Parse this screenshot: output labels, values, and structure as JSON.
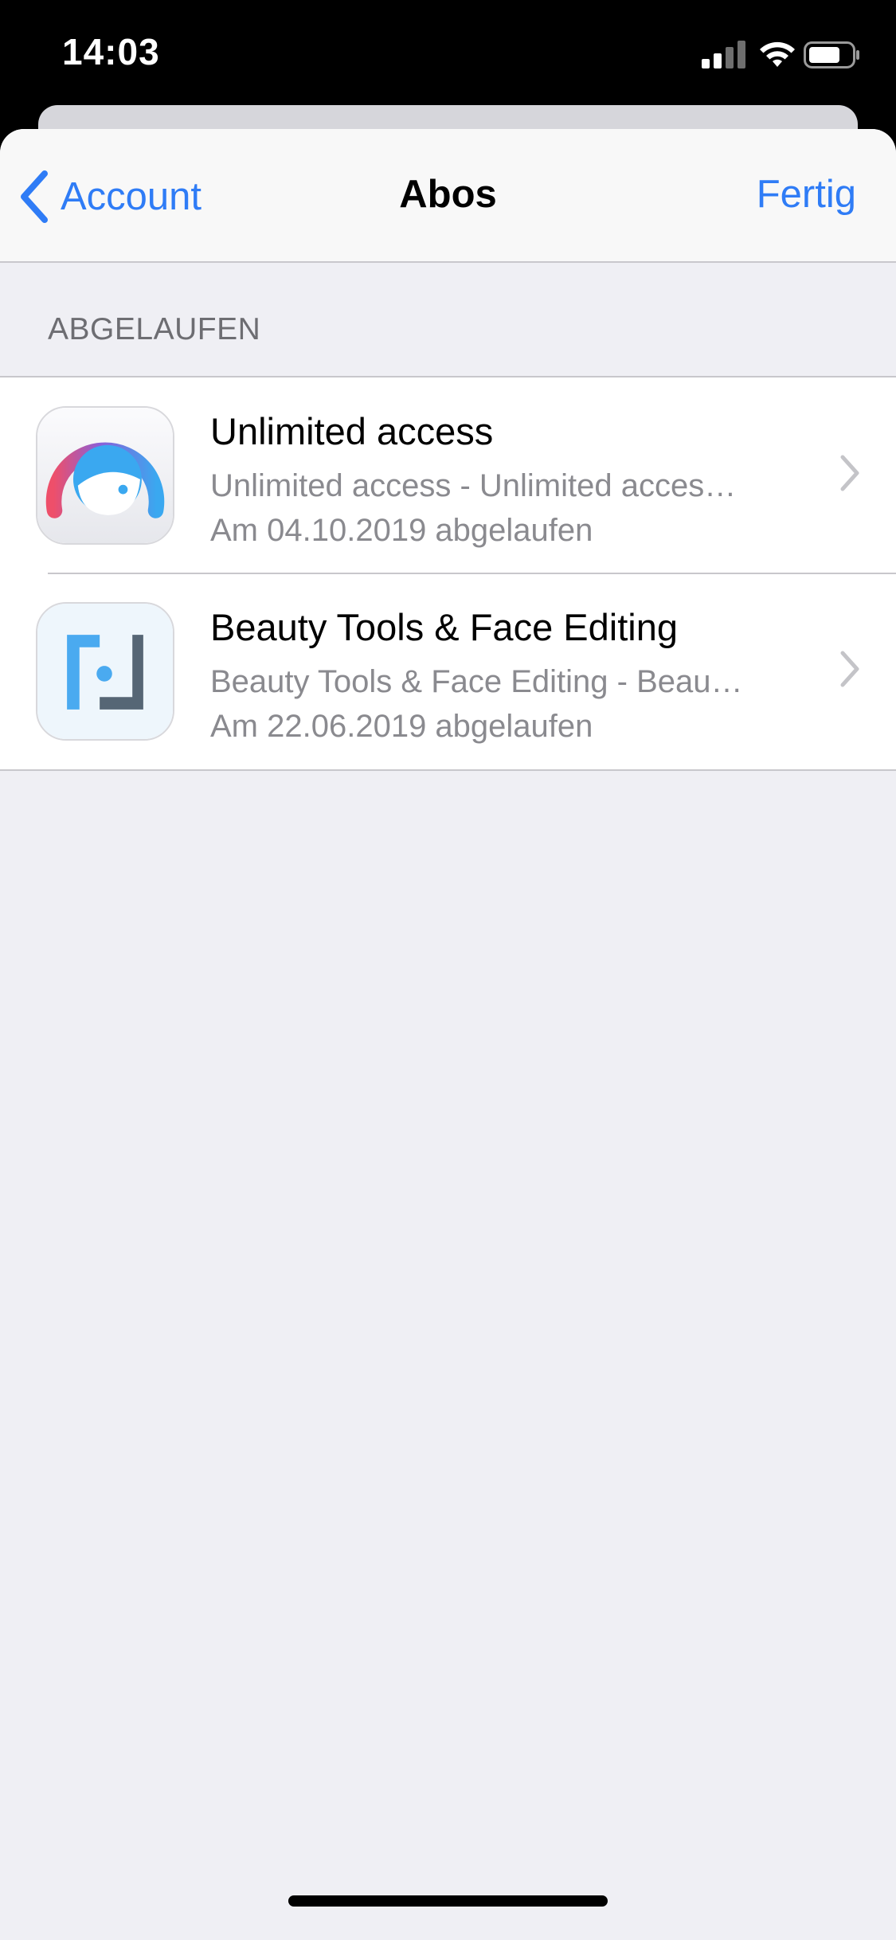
{
  "status_bar": {
    "time": "14:03",
    "icons": [
      "signal-icon",
      "wifi-icon",
      "battery-icon"
    ]
  },
  "nav": {
    "back_label": "Account",
    "title": "Abos",
    "done_label": "Fertig"
  },
  "section": {
    "header": "ABGELAUFEN"
  },
  "subscriptions": [
    {
      "icon": "facetune-app-icon",
      "title": "Unlimited access",
      "subtitle": "Unlimited access - Unlimited acces…",
      "date": "Am 04.10.2019 abgelaufen"
    },
    {
      "icon": "beauty-tools-app-icon",
      "title": "Beauty Tools & Face Editing",
      "subtitle": "Beauty Tools & Face Editing - Beau…",
      "date": "Am 22.06.2019 abgelaufen"
    }
  ],
  "colors": {
    "accent": "#2f7cf6",
    "background": "#efeff4",
    "secondary_text": "#8a8a8f"
  }
}
